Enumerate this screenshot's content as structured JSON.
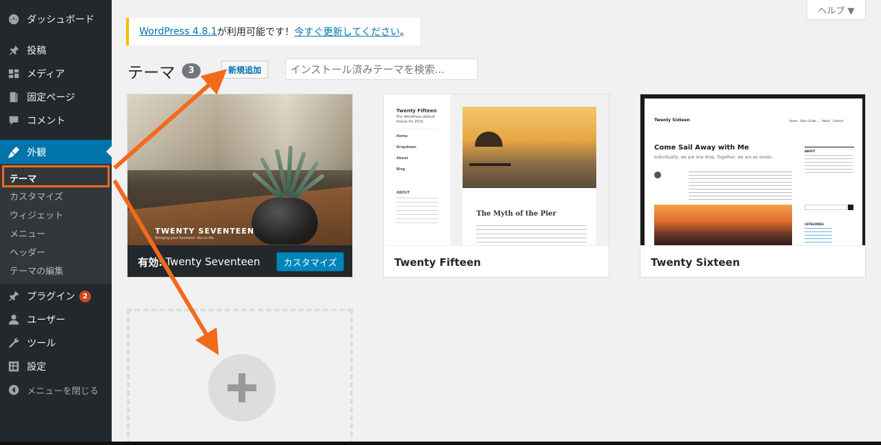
{
  "sidebar": {
    "items": [
      {
        "label": "ダッシュボード",
        "icon": "dashboard-icon"
      },
      {
        "label": "投稿",
        "icon": "pin-icon"
      },
      {
        "label": "メディア",
        "icon": "media-icon"
      },
      {
        "label": "固定ページ",
        "icon": "page-icon"
      },
      {
        "label": "コメント",
        "icon": "comment-icon"
      },
      {
        "label": "外観",
        "icon": "brush-icon"
      },
      {
        "label": "プラグイン",
        "icon": "plugin-icon",
        "badge": "2"
      },
      {
        "label": "ユーザー",
        "icon": "user-icon"
      },
      {
        "label": "ツール",
        "icon": "wrench-icon"
      },
      {
        "label": "設定",
        "icon": "settings-icon"
      },
      {
        "label": "メニューを閉じる",
        "icon": "collapse-icon"
      }
    ],
    "submenu": [
      "テーマ",
      "カスタマイズ",
      "ウィジェット",
      "メニュー",
      "ヘッダー",
      "テーマの編集"
    ]
  },
  "help_label": "ヘルプ ▼",
  "notice": {
    "link1": "WordPress 4.8.1",
    "middle": " が利用可能です！",
    "link2": "今すぐ更新してください",
    "end": "。"
  },
  "heading": {
    "title": "テーマ",
    "count": "3",
    "add_new": "新規追加",
    "search_placeholder": "インストール済みテーマを検索..."
  },
  "themes": {
    "active_prefix": "有効:",
    "seventeen": {
      "name": "Twenty Seventeen",
      "caption": "TWENTY SEVENTEEN",
      "tagline": "Bringing your business' site to life",
      "customize": "カスタマイズ"
    },
    "fifteen": {
      "name": "Twenty Fifteen",
      "site_title": "Twenty Fifteen",
      "post_title": "The Myth of the Pier",
      "nav": [
        "Home",
        "Dropdown",
        "About",
        "Blog"
      ],
      "about": "ABOUT"
    },
    "sixteen": {
      "name": "Twenty Sixteen",
      "site_title": "Twenty Sixteen",
      "post_title": "Come Sail Away with Me",
      "post_sub": "Individually, we are one drop. Together, we are an ocean.",
      "nav": "Home   Style Guide ⌄   About   Contact",
      "about": "ABOUT",
      "categories": "CATEGORIES"
    }
  },
  "colors": {
    "accent": "#0073aa",
    "arrow": "#f26a1b",
    "sidebar": "#23282d"
  }
}
